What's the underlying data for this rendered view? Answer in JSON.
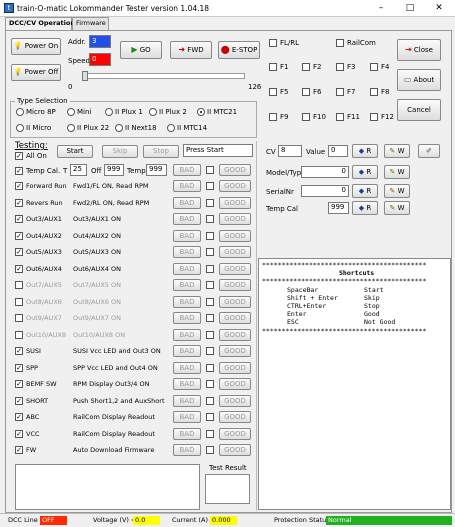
{
  "window": {
    "title": "train-O-matic Lokommander Tester version  1.04.18",
    "buttons": [
      "–",
      "□",
      "✕"
    ]
  },
  "tabs": [
    "DCC/CV Operation",
    "Firmware"
  ],
  "top": {
    "power_on": "Power On",
    "power_off": "Power Off",
    "addr_label": "Addr.",
    "addr_value": "3",
    "speed_label": "Speed",
    "speed_value": "0",
    "go": "GO",
    "fwd": "FWD",
    "estop": "E-STOP",
    "slider_min": "0",
    "slider_max": "126",
    "slider_value": 0,
    "fl_label": "FL/RL",
    "railcom_label": "RailCom",
    "close": "Close",
    "about": "About",
    "cancel": "Cancel",
    "functions": [
      "F1",
      "F2",
      "F3",
      "F4",
      "F5",
      "F6",
      "F7",
      "F8",
      "F9",
      "F10",
      "F11",
      "F12"
    ]
  },
  "type_selection": {
    "title": "Type Selection",
    "options": [
      "Micro 8P",
      "Mini",
      "II Plux 1",
      "II Plux 2",
      "II MTC21",
      "II Micro",
      "II Plux 22",
      "II Next18",
      "II MTC14"
    ],
    "selected": "II MTC21"
  },
  "testing": {
    "title": "Testing:",
    "all_on": "All On",
    "start": "Start",
    "skip": "Skip",
    "stop": "Stop",
    "message": "Press Start",
    "temp_cal": "Temp Cal.",
    "t_label": "T",
    "t_value": "25",
    "off_label": "Off",
    "off_value": "999",
    "temp_label": "Temp",
    "temp_value": "999",
    "bad": "BAD",
    "good": "GOOD",
    "rows": [
      {
        "name": "Forward Run",
        "desc": "Fwd1/FL ON, Read RPM",
        "checked": true,
        "enabled": true
      },
      {
        "name": "Revers Run",
        "desc": "Fwd2/RL ON, Read RPM",
        "checked": true,
        "enabled": true
      },
      {
        "name": "Out3/AUX1",
        "desc": "Out3/AUX1 ON",
        "checked": true,
        "enabled": true
      },
      {
        "name": "Out4/AUX2",
        "desc": "Out4/AUX2 ON",
        "checked": true,
        "enabled": true
      },
      {
        "name": "Out5/AUX3",
        "desc": "Out5/AUX3 ON",
        "checked": true,
        "enabled": true
      },
      {
        "name": "Out6/AUX4",
        "desc": "Out6/AUX4 ON",
        "checked": true,
        "enabled": true
      },
      {
        "name": "Out7/AUX5",
        "desc": "Out7/AUX5 ON",
        "checked": false,
        "enabled": false
      },
      {
        "name": "Out8/AUX6",
        "desc": "Out8/AUX6 ON",
        "checked": false,
        "enabled": false
      },
      {
        "name": "Out9/AUX7",
        "desc": "Out9/AUX7 ON",
        "checked": false,
        "enabled": false
      },
      {
        "name": "Out10/AUX8",
        "desc": "Out10/AUX8 ON",
        "checked": false,
        "enabled": false
      },
      {
        "name": "SUSI",
        "desc": "SUSI Vcc LED and Out3 ON",
        "checked": true,
        "enabled": true
      },
      {
        "name": "SPP",
        "desc": "SPP  Vcc LED and Out4 ON",
        "checked": true,
        "enabled": true
      },
      {
        "name": "BEMF SW",
        "desc": "RPM Display  Out3/4 ON",
        "checked": true,
        "enabled": true
      },
      {
        "name": "SHORT",
        "desc": "Push Short1,2 and AuxShort",
        "checked": true,
        "enabled": true
      },
      {
        "name": "ABC",
        "desc": "RailCom Display Readout",
        "checked": true,
        "enabled": true
      },
      {
        "name": "VCC",
        "desc": "RailCom Display Readout",
        "checked": true,
        "enabled": true
      },
      {
        "name": "FW",
        "desc": "Auto Download Firmware",
        "checked": true,
        "enabled": true
      }
    ],
    "test_result": "Test Result"
  },
  "cv": {
    "cv_label": "CV",
    "cv_value": "8",
    "value_label": "Value",
    "value_value": "0",
    "model_label": "Model/Type",
    "model_value": "0",
    "serial_label": "SerialNr",
    "serial_value": "0",
    "tempcal_label": "Temp Cal",
    "tempcal_value": "999",
    "r": "R",
    "w": "W"
  },
  "shortcuts": {
    "title": "Shortcuts",
    "items": [
      {
        "key": "SpaceBar",
        "action": "Start"
      },
      {
        "key": "Shift + Enter",
        "action": "Skip"
      },
      {
        "key": "CTRL+Enter",
        "action": "Stop"
      },
      {
        "key": "Enter",
        "action": "Good"
      },
      {
        "key": "ESC",
        "action": "Not Good"
      }
    ]
  },
  "status": {
    "dcc_label": "DCC Line",
    "dcc_value": "OFF",
    "voltage_label": "Voltage (V) =",
    "voltage_value": "0.0",
    "current_label": "Current (A) =",
    "current_value": "0.000",
    "protection_label": "Protection Status",
    "protection_value": "Normal"
  },
  "colors": {
    "addr_bg": "#0000ff",
    "speed_bg": "#ff0000",
    "estop": "#cc0000",
    "go": "#1a8a1a",
    "status_off": "#ff2a00",
    "status_yellow": "#ffff00",
    "status_normal": "#20b020"
  }
}
